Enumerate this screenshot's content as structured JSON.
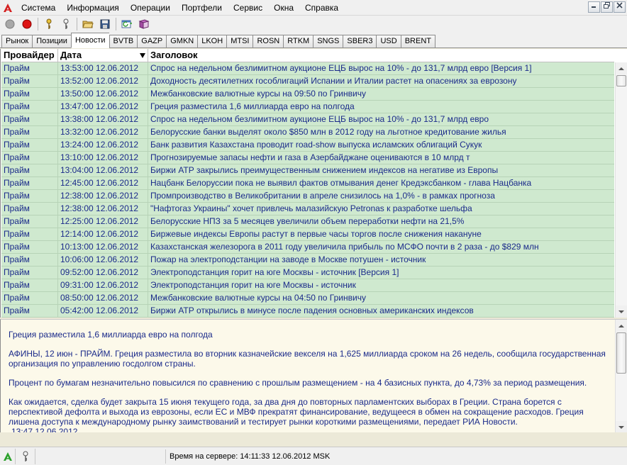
{
  "menu": {
    "items": [
      "Система",
      "Информация",
      "Операции",
      "Портфели",
      "Сервис",
      "Окна",
      "Справка"
    ]
  },
  "window_controls": [
    "minimize-icon",
    "restore-icon",
    "close-icon"
  ],
  "toolbar": {
    "buttons": [
      "gray-circle-icon",
      "red-record-icon",
      "key-icon",
      "key-outline-icon",
      "open-folder-icon",
      "save-disk-icon",
      "refresh-window-icon",
      "book-icon"
    ]
  },
  "tabs": [
    "Рынок",
    "Позиции",
    "Новости",
    "BVTB",
    "GAZP",
    "GMKN",
    "LKOH",
    "MTSI",
    "ROSN",
    "RTKM",
    "SNGS",
    "SBER3",
    "USD",
    "BRENT"
  ],
  "active_tab": "Новости",
  "grid": {
    "columns": {
      "provider": "Провайдер",
      "date": "Дата",
      "title": "Заголовок"
    },
    "rows": [
      {
        "provider": "Прайм",
        "date": "13:53:00 12.06.2012",
        "title": "Спрос на недельном безлимитном аукционе ЕЦБ вырос на 10% - до 131,7 млрд евро [Версия 1]"
      },
      {
        "provider": "Прайм",
        "date": "13:52:00 12.06.2012",
        "title": "Доходность десятилетних гособлигаций Испании и Италии растет на опасениях за еврозону"
      },
      {
        "provider": "Прайм",
        "date": "13:50:00 12.06.2012",
        "title": "Межбанковские валютные курсы на 09:50 по Гринвичу"
      },
      {
        "provider": "Прайм",
        "date": "13:47:00 12.06.2012",
        "title": "Греция разместила 1,6 миллиарда евро на полгода"
      },
      {
        "provider": "Прайм",
        "date": "13:38:00 12.06.2012",
        "title": "Спрос на недельном безлимитном аукционе ЕЦБ вырос на 10% - до 131,7 млрд евро"
      },
      {
        "provider": "Прайм",
        "date": "13:32:00 12.06.2012",
        "title": "Белорусские банки выделят около $850 млн в 2012 году на льготное кредитование жилья"
      },
      {
        "provider": "Прайм",
        "date": "13:24:00 12.06.2012",
        "title": "Банк развития Казахстана проводит road-show выпуска исламских облигаций Сукук"
      },
      {
        "provider": "Прайм",
        "date": "13:10:00 12.06.2012",
        "title": "Прогнозируемые запасы нефти и газа в Азербайджане оцениваются в 10 млрд т"
      },
      {
        "provider": "Прайм",
        "date": "13:04:00 12.06.2012",
        "title": "Биржи АТР закрылись преимущественным снижением индексов на негативе из Европы"
      },
      {
        "provider": "Прайм",
        "date": "12:45:00 12.06.2012",
        "title": "Нацбанк Белоруссии пока не выявил фактов отмывания денег Кредэксбанком - глава Нацбанка"
      },
      {
        "provider": "Прайм",
        "date": "12:38:00 12.06.2012",
        "title": "Промпроизводство в Великобритании в апреле снизилось на 1,0% - в рамках прогноза"
      },
      {
        "provider": "Прайм",
        "date": "12:38:00 12.06.2012",
        "title": "\"Нафтогаз Украины\" хочет привлечь малазийскую Petronas к разработке шельфа"
      },
      {
        "provider": "Прайм",
        "date": "12:25:00 12.06.2012",
        "title": "Белорусские НПЗ за 5 месяцев увеличили объем переработки нефти на 21,5%"
      },
      {
        "provider": "Прайм",
        "date": "12:14:00 12.06.2012",
        "title": "Биржевые индексы Европы растут в первые часы торгов после снижения накануне"
      },
      {
        "provider": "Прайм",
        "date": "10:13:00 12.06.2012",
        "title": "Казахстанская железорога в 2011 году увеличила прибыль по МСФО почти в 2 раза - до $829 млн"
      },
      {
        "provider": "Прайм",
        "date": "10:06:00 12.06.2012",
        "title": "Пожар на электроподстанции на заводе в Москве потушен - источник"
      },
      {
        "provider": "Прайм",
        "date": "09:52:00 12.06.2012",
        "title": "Электроподстанция горит на юге Москвы - источник [Версия 1]"
      },
      {
        "provider": "Прайм",
        "date": "09:31:00 12.06.2012",
        "title": "Электроподстанция горит на юге Москвы - источник"
      },
      {
        "provider": "Прайм",
        "date": "08:50:00 12.06.2012",
        "title": "Межбанковские валютные курсы на 04:50 по Гринвичу"
      },
      {
        "provider": "Прайм",
        "date": "05:42:00 12.06.2012",
        "title": "Биржи АТР открылись в минусе после падения основных американских индексов"
      }
    ]
  },
  "article": {
    "headline": "Греция разместила 1,6 миллиарда евро на полгода",
    "paragraphs": [
      "АФИНЫ, 12 июн - ПРАЙМ. Греция разместила во вторник казначейские векселя на 1,625 миллиарда сроком на 26 недель, сообщила государственная организация по управлению госдолгом страны.",
      "Процент по бумагам незначительно повысился по сравнению с прошлым размещением - на 4 базисных пункта, до 4,73% за период размещения.",
      "Как ожидается, сделка будет закрыта 15 июня текущего года, за два дня до повторных парламентских выборах в Греции. Страна борется с перспективой дефолта и выхода из еврозоны, если ЕС и МВФ прекратят финансирование, ведущееся в обмен на сокращение расходов. Греция лишена доступа к международному рынку заимствований и тестирует рынки короткими размещениями, передает РИА Новости."
    ],
    "timestamp": "13:47 12.06.2012"
  },
  "status": {
    "server_time": "Время на сервере: 14:11:33 12.06.2012 MSK"
  },
  "colors": {
    "row_bg": "#cfe9cf",
    "row_text": "#1a2a8a",
    "article_bg": "#fcf9ea",
    "logo_red": "#d42020",
    "status_icon_green": "#2aa02a"
  }
}
